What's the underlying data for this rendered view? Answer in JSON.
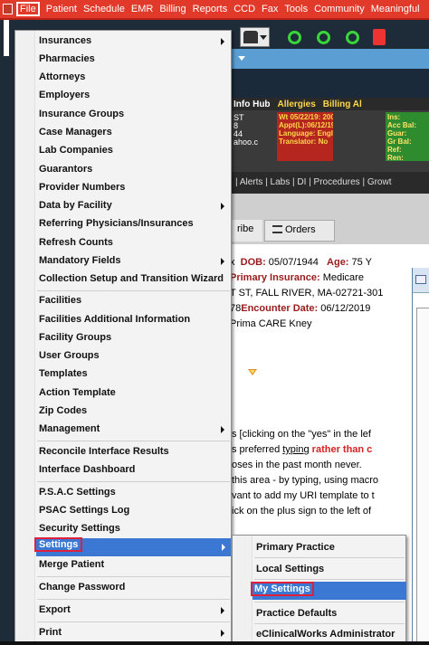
{
  "menubar": {
    "items": [
      "File",
      "Patient",
      "Schedule",
      "EMR",
      "Billing",
      "Reports",
      "CCD",
      "Fax",
      "Tools",
      "Community",
      "Meaningful"
    ]
  },
  "header": {
    "hub_tab": "Info Hub",
    "allergies_tab": "Allergies",
    "billing_alerts_tab": "Billing Al",
    "info_col": [
      "ST",
      "8",
      "44",
      "ahoo.c"
    ],
    "allergy_lines": [
      "Wt 05/22/19: 200 lbs.",
      "Appt(L):06/12/19(BK)",
      "Language: English",
      "Translator: No"
    ],
    "billing_lines": [
      "Ins:",
      "Acc Bal:",
      "Guar:",
      "Gr Bal:",
      "Ref:",
      "Ren:"
    ],
    "nav_links": "| Alerts | Labs | DI | Procedures | Growt",
    "tab_prescribe": "ribe",
    "tab_orders": "Orders"
  },
  "demographics": {
    "dob_label": "DOB:",
    "dob": "05/07/1944",
    "age_label": "Age:",
    "age": "75 Y",
    "ins_label": "Primary Insurance:",
    "ins": "Medicare",
    "address": "T ST, FALL RIVER, MA-02721-301",
    "enc_prefix": "78",
    "enc_label": "Encounter Date:",
    "enc_date": "06/12/2019",
    "facility": "Prima CARE Kney"
  },
  "note": {
    "line1": "s [clicking on the \"yes\" in the lef",
    "line2_a": "s preferred ",
    "line2_b": "typing",
    "line2_c": " rather ",
    "line2_d": "than c",
    "line3_a": "oses in the past month  ",
    "line3_b": "never.",
    "line4_a": "this area - by typing, using macro",
    "line5": "vant to add my URI template to t",
    "line6": "ick on the plus sign to the left of"
  },
  "file_menu": {
    "items": [
      {
        "label": "Insurances",
        "submenu": true
      },
      {
        "label": "Pharmacies"
      },
      {
        "label": "Attorneys"
      },
      {
        "label": "Employers"
      },
      {
        "label": "Insurance Groups"
      },
      {
        "label": "Case Managers"
      },
      {
        "label": "Lab Companies"
      },
      {
        "label": "Guarantors"
      },
      {
        "label": "Provider Numbers"
      },
      {
        "label": "Data by Facility",
        "submenu": true
      },
      {
        "label": "Referring Physicians/Insurances"
      },
      {
        "label": "Refresh Counts"
      },
      {
        "label": "Mandatory Fields",
        "submenu": true
      },
      {
        "label": "Collection Setup and Transition Wizard"
      },
      {
        "label": "Facilities"
      },
      {
        "label": "Facilities Additional Information"
      },
      {
        "label": "Facility Groups"
      },
      {
        "label": "User Groups"
      },
      {
        "label": "Templates"
      },
      {
        "label": "Action Template"
      },
      {
        "label": "Zip Codes"
      },
      {
        "label": "Management",
        "submenu": true
      },
      {
        "label": "Reconcile Interface Results"
      },
      {
        "label": "Interface Dashboard"
      },
      {
        "label": "P.S.A.C Settings"
      },
      {
        "label": "PSAC Settings Log"
      },
      {
        "label": "Security Settings"
      },
      {
        "label": "Settings",
        "submenu": true
      },
      {
        "label": "Merge Patient"
      },
      {
        "label": "Change Password"
      },
      {
        "label": "Export",
        "submenu": true
      },
      {
        "label": "Print",
        "submenu": true
      }
    ]
  },
  "settings_submenu": {
    "items": [
      "Primary Practice",
      "Local Settings",
      "My Settings",
      "Practice Defaults",
      "eClinicalWorks Administrator"
    ]
  },
  "colors": {
    "menubar": "#e23a2a",
    "highlight": "#3a78d3",
    "callout": "#e0203a"
  }
}
